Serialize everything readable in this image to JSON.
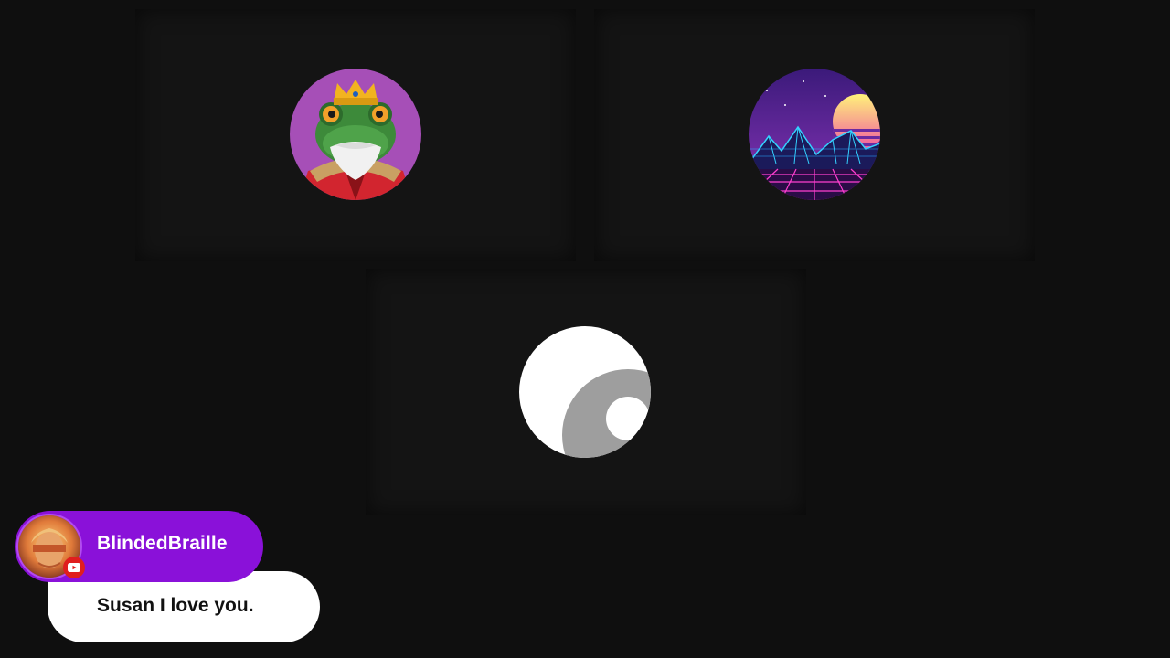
{
  "participants": [
    {
      "avatar": "frog-king-avatar"
    },
    {
      "avatar": "synthwave-mountain-avatar"
    },
    {
      "avatar": "default-user-avatar"
    }
  ],
  "chat": {
    "username": "BlindedBraille",
    "message": "Susan I love you.",
    "platform_badge": "youtube-icon",
    "colors": {
      "name_pill": "#8a11d9",
      "bubble": "#ffffff",
      "badge": "#e01e1e"
    }
  },
  "colors": {
    "background": "#0f0f0f",
    "tile": "#141414"
  }
}
